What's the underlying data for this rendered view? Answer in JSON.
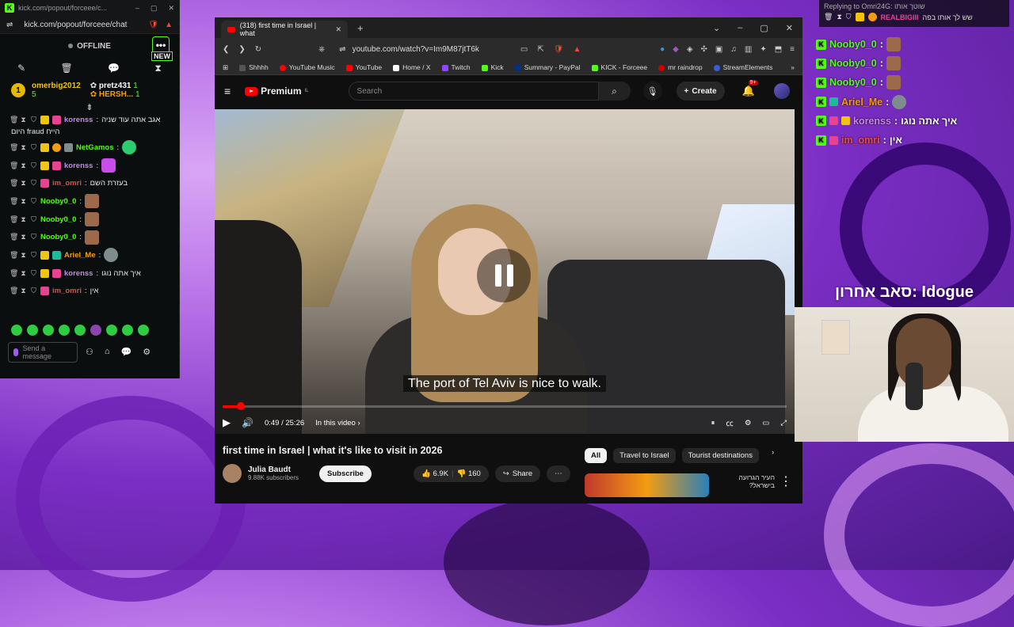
{
  "kick": {
    "window_title": "kick.com/popout/forceee/c...",
    "url": "kick.com/popout/forceee/chat",
    "status": "OFFLINE",
    "new_label": "NEW",
    "more_glyph": "•••",
    "gifters": [
      {
        "rank": "1",
        "name": "omerbig2012",
        "count": "5"
      },
      {
        "name": "pretz431",
        "count": "1"
      },
      {
        "name": "HERSH...",
        "count": "1"
      }
    ],
    "messages": [
      {
        "name": "korenss",
        "text": "אגב אתה עוד שניה",
        "text2": "היום fraud הייח",
        "color": "#c586e8"
      },
      {
        "name": "NetGamos",
        "text": "",
        "color": "#53fc18"
      },
      {
        "name": "korenss",
        "text": "",
        "color": "#c586e8"
      },
      {
        "name": "im_omri",
        "text": "בעזרת השם",
        "color": "#e74c3c"
      },
      {
        "name": "Nooby0_0",
        "text": "",
        "color": "#53fc18"
      },
      {
        "name": "Nooby0_0",
        "text": "",
        "color": "#53fc18"
      },
      {
        "name": "Nooby0_0",
        "text": "",
        "color": "#53fc18"
      },
      {
        "name": "Ariel_Me",
        "text": "",
        "color": "#f39c12"
      },
      {
        "name": "korenss",
        "text": "איך אתה נוגו",
        "color": "#c586e8"
      },
      {
        "name": "im_omri",
        "text": "אין",
        "color": "#e74c3c"
      }
    ],
    "input_placeholder": "Send a message"
  },
  "browser": {
    "tab_title": "(318) first time in Israel | what",
    "url": "youtube.com/watch?v=Im9M87jtT6k",
    "bookmarks": [
      "Shhhh",
      "YouTube Music",
      "YouTube",
      "Home / X",
      "Twitch",
      "Kick",
      "Summary - PayPal",
      "KICK - Forceee",
      "mr raindrop",
      "StreamElements"
    ],
    "bookmark_colors": [
      "#555",
      "#ff0000",
      "#ff0000",
      "#fff",
      "#9146ff",
      "#53fc18",
      "#003087",
      "#53fc18",
      "#cc0000",
      "#3b5bdb"
    ]
  },
  "youtube": {
    "logo": "Premium",
    "logo_sup": "IL",
    "search_placeholder": "Search",
    "create_label": "Create",
    "notif_count": "9+",
    "subtitle": "The port of Tel Aviv is nice to walk.",
    "time": "0:49 / 25:26",
    "in_this_video": "In this video",
    "progress_fraction": 0.032,
    "video_title": "first time in Israel | what it's like to visit in 2026",
    "channel": "Julia Baudt",
    "subscribers": "9.88K subscribers",
    "subscribe_label": "Subscribe",
    "likes": "6.9K",
    "dislikes": "160",
    "share_label": "Share",
    "chips": [
      "All",
      "Travel to Israel",
      "Tourist destinations"
    ],
    "rec_title": "העיר הגרועה בישראל?"
  },
  "overlay": {
    "reply_to": "Replying to Omri24G: שוטך אותו",
    "reply_user": "REALBIGIII",
    "reply_text": "שש לך אותו בפה",
    "messages": [
      {
        "name": "Nooby0_0",
        "text": "",
        "color": "#53fc18"
      },
      {
        "name": "Nooby0_0",
        "text": "",
        "color": "#53fc18"
      },
      {
        "name": "Nooby0_0",
        "text": "",
        "color": "#53fc18"
      },
      {
        "name": "Ariel_Me",
        "text": "",
        "color": "#f39c12"
      },
      {
        "name": "korenss",
        "text": "איך אתה נוגו",
        "color": "#c586e8"
      },
      {
        "name": "im_omri",
        "text": "אין",
        "color": "#e74c3c"
      }
    ],
    "banner": "סאב אחרון: Idogue"
  }
}
